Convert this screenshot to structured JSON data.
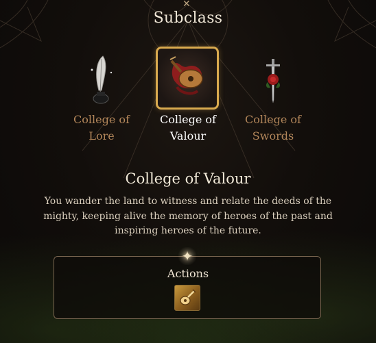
{
  "panel": {
    "title": "Subclass"
  },
  "options": [
    {
      "label": "College of Lore",
      "icon": "quill-inkwell-icon",
      "selected": false
    },
    {
      "label": "College of Valour",
      "icon": "lute-red-cloth-icon",
      "selected": true
    },
    {
      "label": "College of Swords",
      "icon": "dagger-rose-icon",
      "selected": false
    }
  ],
  "description": {
    "title": "College of Valour",
    "text": "You wander the land to witness and relate the deeds of the mighty, keeping alive the memory of heroes of the past and inspiring heroes of the future."
  },
  "actions": {
    "label": "Actions",
    "items": [
      {
        "icon": "lute-action-icon"
      }
    ]
  },
  "colors": {
    "accent_gold": "#d9aa4f",
    "label_dim": "#b2865a",
    "label_active": "#ffffff"
  }
}
